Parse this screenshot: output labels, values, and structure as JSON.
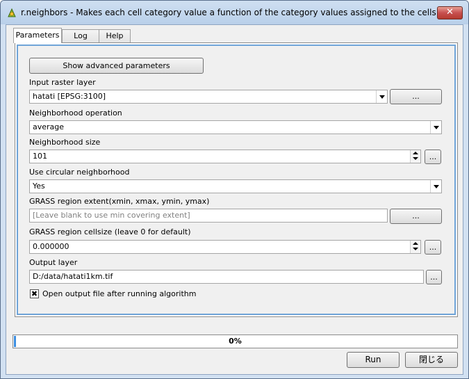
{
  "window": {
    "title": "r.neighbors - Makes each cell category value a function of the category values assigned to the cells a...",
    "close_symbol": "✕",
    "icon": "qgis-icon"
  },
  "tabs": [
    {
      "label": "Parameters",
      "active": true
    },
    {
      "label": "Log",
      "active": false
    },
    {
      "label": "Help",
      "active": false
    }
  ],
  "params": {
    "advanced_button": "Show advanced parameters",
    "input_raster_label": "Input raster layer",
    "input_raster_value": "hatati [EPSG:3100]",
    "browse_label": "...",
    "operation_label": "Neighborhood operation",
    "operation_value": "average",
    "size_label": "Neighborhood size",
    "size_value": "101",
    "circular_label": "Use circular neighborhood",
    "circular_value": "Yes",
    "extent_label": "GRASS region extent(xmin, xmax, ymin, ymax)",
    "extent_placeholder": "[Leave blank to use min covering extent]",
    "cellsize_label": "GRASS region cellsize (leave 0 for default)",
    "cellsize_value": "0.000000",
    "output_label": "Output layer",
    "output_value": "D:/data/hatati1km.tif",
    "open_output_label": "Open output file after running algorithm",
    "open_output_checked": true,
    "check_mark": "✖"
  },
  "progress": {
    "value": 0,
    "text": "0%",
    "color": "#3c8ee0"
  },
  "footer": {
    "run_label": "Run",
    "close_label": "閉じる"
  }
}
